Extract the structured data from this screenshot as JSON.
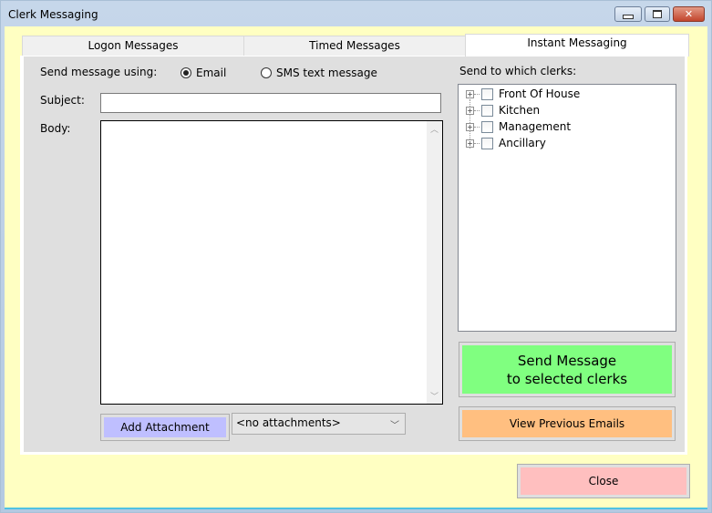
{
  "window": {
    "title": "Clerk Messaging",
    "controls": {
      "minimize": "minimize",
      "maximize": "maximize",
      "close": "close"
    }
  },
  "tabs": [
    {
      "label": "Logon Messages",
      "active": false
    },
    {
      "label": "Timed Messages",
      "active": false
    },
    {
      "label": "Instant Messaging",
      "active": true
    }
  ],
  "form": {
    "send_using_label": "Send message using:",
    "options": [
      {
        "label": "Email",
        "selected": true
      },
      {
        "label": "SMS text message",
        "selected": false
      }
    ],
    "subject_label": "Subject:",
    "subject_value": "",
    "body_label": "Body:",
    "body_value": "",
    "add_attachment_label": "Add Attachment",
    "attachments_selected": "<no attachments>"
  },
  "clerks": {
    "label": "Send to which clerks:",
    "groups": [
      {
        "label": "Front Of House",
        "checked": false,
        "expanded": false
      },
      {
        "label": "Kitchen",
        "checked": false,
        "expanded": false
      },
      {
        "label": "Management",
        "checked": false,
        "expanded": false
      },
      {
        "label": "Ancillary",
        "checked": false,
        "expanded": false
      }
    ]
  },
  "actions": {
    "send_line1": "Send Message",
    "send_line2": "to selected clerks",
    "view_previous": "View Previous Emails",
    "close": "Close"
  },
  "colors": {
    "client_bg": "#ffffc2",
    "send_button": "#80ff80",
    "view_button": "#ffbf80",
    "close_button": "#ffbfbf",
    "attachment_button": "#bfbfff"
  }
}
